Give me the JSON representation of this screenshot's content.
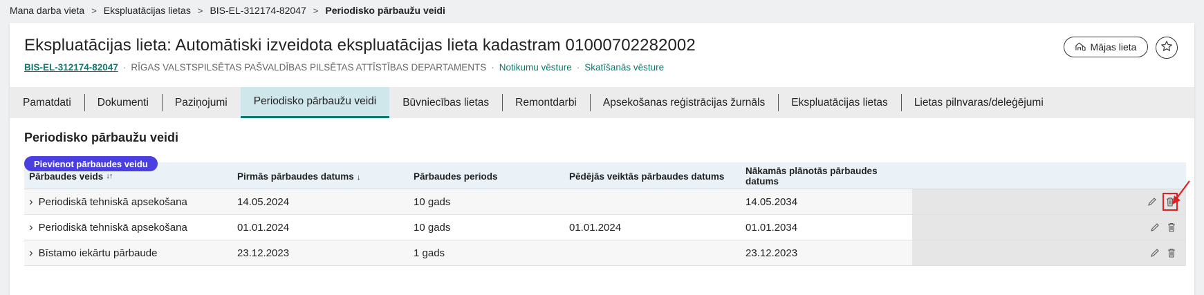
{
  "breadcrumb": {
    "items": [
      "Mana darba vieta",
      "Ekspluatācijas lietas",
      "BIS-EL-312174-82047"
    ],
    "current": "Periodisko pārbaužu veidi",
    "separator": ">"
  },
  "header": {
    "title": "Ekspluatācijas lieta: Automātiski izveidota ekspluatācijas lieta kadastram 01000702282002",
    "code": "BIS-EL-312174-82047",
    "department": "Rīgas valstspilsētas pašvaldības pilsētas attīstības departaments",
    "events_link": "Notikumu vēsture",
    "views_link": "Skatīšanās vēsture",
    "house_button": "Mājas lieta",
    "house_icon": "house-icon",
    "star_icon": "star-icon"
  },
  "tabs": [
    {
      "label": "Pamatdati"
    },
    {
      "label": "Dokumenti"
    },
    {
      "label": "Paziņojumi"
    },
    {
      "label": "Periodisko pārbaužu veidi",
      "active": true
    },
    {
      "label": "Būvniecības lietas"
    },
    {
      "label": "Remontdarbi"
    },
    {
      "label": "Apsekošanas reģistrācijas žurnāls"
    },
    {
      "label": "Ekspluatācijas lietas"
    },
    {
      "label": "Lietas pilnvaras/deleģējumi"
    }
  ],
  "section": {
    "title": "Periodisko pārbaužu veidi",
    "add_button": "Pievienot pārbaudes veidu"
  },
  "table": {
    "columns": [
      {
        "label": "Pārbaudes veids",
        "sort": "↓↑"
      },
      {
        "label": "Pirmās pārbaudes datums",
        "sort": "↓"
      },
      {
        "label": "Pārbaudes periods",
        "sort": ""
      },
      {
        "label": "Pēdējās veiktās pārbaudes datums",
        "sort": ""
      },
      {
        "label": "Nākamās plānotās pārbaudes datums",
        "sort": ""
      }
    ],
    "rows": [
      {
        "type": "Periodiskā tehniskā apsekošana",
        "first_date": "14.05.2024",
        "period": "10 gads",
        "last_date": "",
        "next_date": "14.05.2034"
      },
      {
        "type": "Periodiskā tehniskā apsekošana",
        "first_date": "01.01.2024",
        "period": "10 gads",
        "last_date": "01.01.2024",
        "next_date": "01.01.2034"
      },
      {
        "type": "Bīstamo iekārtu pārbaude",
        "first_date": "23.12.2023",
        "period": "1 gads",
        "last_date": "",
        "next_date": "23.12.2023"
      }
    ],
    "row_icons": [
      "pencil-icon",
      "trash-icon"
    ]
  },
  "colors": {
    "accent": "#0b7a6e",
    "primary_button": "#4a3fe0",
    "highlight": "#e02020"
  }
}
